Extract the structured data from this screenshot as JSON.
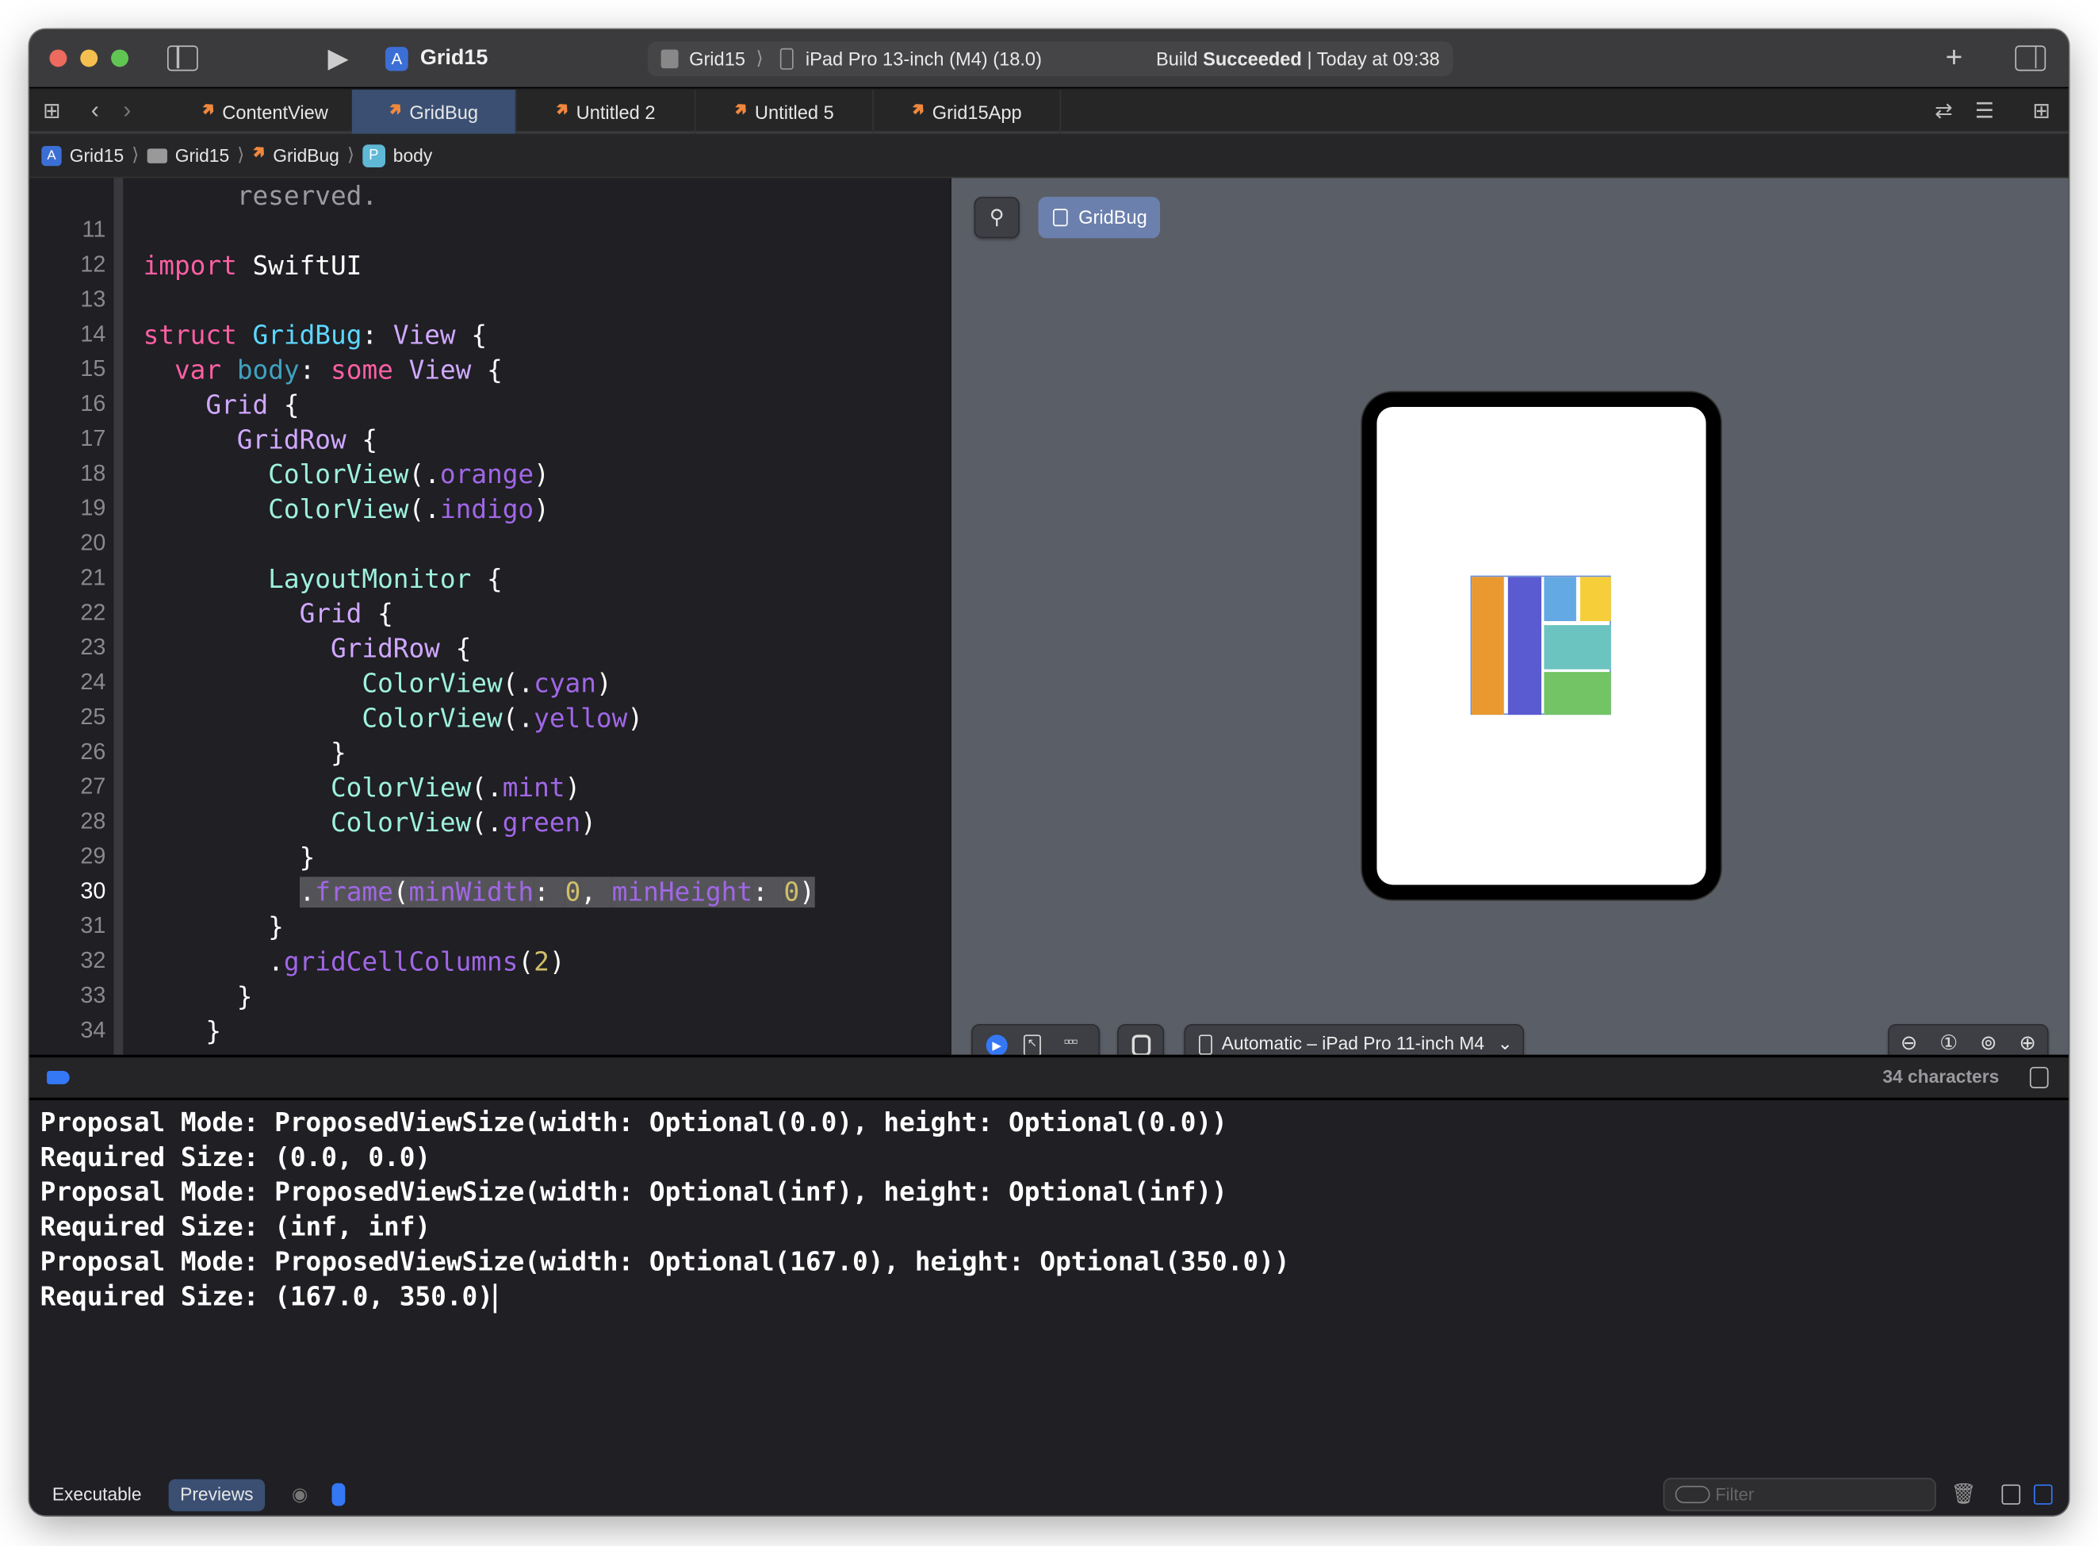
{
  "window": {
    "project_title": "Grid15",
    "scheme": {
      "target": "Grid15",
      "device": "iPad Pro 13-inch (M4) (18.0)"
    },
    "status": {
      "prefix": "Build",
      "state": "Succeeded",
      "time": "Today at 09:38"
    }
  },
  "tabs": [
    {
      "label": "ContentView",
      "selected": false
    },
    {
      "label": "GridBug",
      "selected": true
    },
    {
      "label": "Untitled 2",
      "selected": false
    },
    {
      "label": "Untitled 5",
      "selected": false
    },
    {
      "label": "Grid15App",
      "selected": false
    }
  ],
  "breadcrumb": [
    "Grid15",
    "Grid15",
    "GridBug",
    "body"
  ],
  "breadcrumb_badge": "P",
  "editor": {
    "current_line": "30",
    "lines": [
      {
        "n": "",
        "t": [
          [
            "      reserved.",
            "cm"
          ]
        ]
      },
      {
        "n": "11",
        "t": []
      },
      {
        "n": "12",
        "t": [
          [
            "import",
            "k"
          ],
          [
            " SwiftUI",
            "pl"
          ]
        ]
      },
      {
        "n": "13",
        "t": []
      },
      {
        "n": "14",
        "t": [
          [
            "struct",
            "k"
          ],
          [
            " ",
            "pl"
          ],
          [
            "GridBug",
            "td"
          ],
          [
            ": ",
            "pl"
          ],
          [
            "View",
            "ty"
          ],
          [
            " {",
            "pl"
          ]
        ]
      },
      {
        "n": "15",
        "t": [
          [
            "  ",
            "pl"
          ],
          [
            "var",
            "k"
          ],
          [
            " ",
            "pl"
          ],
          [
            "body",
            "bd"
          ],
          [
            ": ",
            "pl"
          ],
          [
            "some",
            "k"
          ],
          [
            " ",
            "pl"
          ],
          [
            "View",
            "ty"
          ],
          [
            " {",
            "pl"
          ]
        ]
      },
      {
        "n": "16",
        "t": [
          [
            "    ",
            "pl"
          ],
          [
            "Grid",
            "ty"
          ],
          [
            " {",
            "pl"
          ]
        ]
      },
      {
        "n": "17",
        "t": [
          [
            "      ",
            "pl"
          ],
          [
            "GridRow",
            "ty"
          ],
          [
            " {",
            "pl"
          ]
        ]
      },
      {
        "n": "18",
        "t": [
          [
            "        ",
            "pl"
          ],
          [
            "ColorView",
            "pt"
          ],
          [
            "(.",
            "pl"
          ],
          [
            "orange",
            "pr"
          ],
          [
            ")",
            "pl"
          ]
        ]
      },
      {
        "n": "19",
        "t": [
          [
            "        ",
            "pl"
          ],
          [
            "ColorView",
            "pt"
          ],
          [
            "(.",
            "pl"
          ],
          [
            "indigo",
            "pr"
          ],
          [
            ")",
            "pl"
          ]
        ]
      },
      {
        "n": "20",
        "t": []
      },
      {
        "n": "21",
        "t": [
          [
            "        ",
            "pl"
          ],
          [
            "LayoutMonitor",
            "pt"
          ],
          [
            " {",
            "pl"
          ]
        ]
      },
      {
        "n": "22",
        "t": [
          [
            "          ",
            "pl"
          ],
          [
            "Grid",
            "ty"
          ],
          [
            " {",
            "pl"
          ]
        ]
      },
      {
        "n": "23",
        "t": [
          [
            "            ",
            "pl"
          ],
          [
            "GridRow",
            "ty"
          ],
          [
            " {",
            "pl"
          ]
        ]
      },
      {
        "n": "24",
        "t": [
          [
            "              ",
            "pl"
          ],
          [
            "ColorView",
            "pt"
          ],
          [
            "(.",
            "pl"
          ],
          [
            "cyan",
            "pr"
          ],
          [
            ")",
            "pl"
          ]
        ]
      },
      {
        "n": "25",
        "t": [
          [
            "              ",
            "pl"
          ],
          [
            "ColorView",
            "pt"
          ],
          [
            "(.",
            "pl"
          ],
          [
            "yellow",
            "pr"
          ],
          [
            ")",
            "pl"
          ]
        ]
      },
      {
        "n": "26",
        "t": [
          [
            "            }",
            "pl"
          ]
        ]
      },
      {
        "n": "27",
        "t": [
          [
            "            ",
            "pl"
          ],
          [
            "ColorView",
            "pt"
          ],
          [
            "(.",
            "pl"
          ],
          [
            "mint",
            "pr"
          ],
          [
            ")",
            "pl"
          ]
        ]
      },
      {
        "n": "28",
        "t": [
          [
            "            ",
            "pl"
          ],
          [
            "ColorView",
            "pt"
          ],
          [
            "(.",
            "pl"
          ],
          [
            "green",
            "pr"
          ],
          [
            ")",
            "pl"
          ]
        ]
      },
      {
        "n": "29",
        "t": [
          [
            "          }",
            "pl"
          ]
        ]
      },
      {
        "n": "30",
        "hl": true,
        "t": [
          [
            "          ",
            "pl"
          ],
          [
            ".",
            "hl pl"
          ],
          [
            "frame",
            "hl pr"
          ],
          [
            "(",
            "hl pl"
          ],
          [
            "minWidth",
            "hl pr"
          ],
          [
            ": ",
            "hl pl"
          ],
          [
            "0",
            "hl nu"
          ],
          [
            ", ",
            "hl pl"
          ],
          [
            "minHeight",
            "hl pr"
          ],
          [
            ": ",
            "hl pl"
          ],
          [
            "0",
            "hl nu"
          ],
          [
            ")",
            "hl pl"
          ]
        ]
      },
      {
        "n": "31",
        "t": [
          [
            "        }",
            "pl"
          ]
        ]
      },
      {
        "n": "32",
        "t": [
          [
            "        .",
            "pl"
          ],
          [
            "gridCellColumns",
            "pr"
          ],
          [
            "(",
            "pl"
          ],
          [
            "2",
            "nu"
          ],
          [
            ")",
            "pl"
          ]
        ]
      },
      {
        "n": "33",
        "t": [
          [
            "      }",
            "pl"
          ]
        ]
      },
      {
        "n": "34",
        "t": [
          [
            "    }",
            "pl"
          ]
        ]
      }
    ]
  },
  "preview": {
    "chip_label": "GridBug",
    "device_menu": "Automatic – iPad Pro 11-inch M4",
    "colors": {
      "orange": "#e9992f",
      "indigo": "#5a5bd0",
      "cyan": "#63a9e3",
      "yellow": "#f6ce3a",
      "mint": "#6bc4bf",
      "green": "#73c464"
    }
  },
  "debug": {
    "char_count": "34 characters"
  },
  "console": [
    "Proposal Mode: ProposedViewSize(width: Optional(0.0), height: Optional(0.0))",
    "Required Size: (0.0, 0.0)",
    "Proposal Mode: ProposedViewSize(width: Optional(inf), height: Optional(inf))",
    "Required Size: (inf, inf)",
    "Proposal Mode: ProposedViewSize(width: Optional(167.0), height: Optional(350.0))",
    "Required Size: (167.0, 350.0)"
  ],
  "bottom": {
    "executable": "Executable",
    "previews": "Previews",
    "filter_placeholder": "Filter"
  },
  "accent": "#3478f6"
}
